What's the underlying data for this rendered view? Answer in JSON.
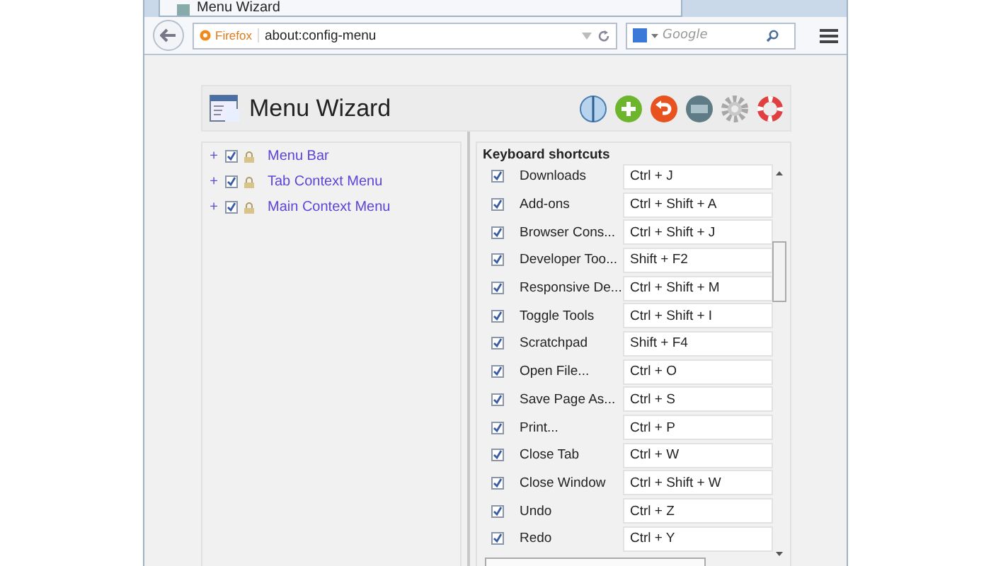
{
  "browser": {
    "tab": {
      "title": "Menu Wizard",
      "selected": true
    },
    "identity": "Firefox",
    "url": "about:config-menu",
    "search": {
      "placeholder": "Google"
    }
  },
  "header": {
    "title": "Menu Wizard"
  },
  "tree": [
    {
      "toggle": "+",
      "label": "Menu Bar",
      "checked": true
    },
    {
      "toggle": "+",
      "label": "Tab Context Menu",
      "checked": true
    },
    {
      "toggle": "+",
      "label": "Main Context Menu",
      "checked": true
    }
  ],
  "shortcuts": {
    "title": "Keyboard shortcuts",
    "rows": [
      {
        "name": "Downloads",
        "checked": true,
        "keys": "Ctrl + J"
      },
      {
        "name": "Add-ons",
        "checked": true,
        "keys": "Ctrl + Shift + A"
      },
      {
        "name": "Browser Cons...",
        "checked": true,
        "keys": "Ctrl + Shift + J"
      },
      {
        "name": "Developer Too...",
        "checked": true,
        "keys": "Shift + F2"
      },
      {
        "name": "Responsive De...",
        "checked": true,
        "keys": "Ctrl + Shift + M"
      },
      {
        "name": "Toggle Tools",
        "checked": true,
        "keys": "Ctrl + Shift + I"
      },
      {
        "name": "Scratchpad",
        "checked": true,
        "keys": "Shift + F4"
      },
      {
        "name": "Open File...",
        "checked": true,
        "keys": "Ctrl + O"
      },
      {
        "name": "Save Page As...",
        "checked": true,
        "keys": "Ctrl + S"
      },
      {
        "name": "Print...",
        "checked": true,
        "keys": "Ctrl + P"
      },
      {
        "name": "Close Tab",
        "checked": true,
        "keys": "Ctrl + W"
      },
      {
        "name": "Close Window",
        "checked": true,
        "keys": "Ctrl + Shift + W"
      },
      {
        "name": "Undo",
        "checked": true,
        "keys": "Ctrl + Z"
      },
      {
        "name": "Redo",
        "checked": true,
        "keys": "Ctrl + Y"
      }
    ]
  }
}
